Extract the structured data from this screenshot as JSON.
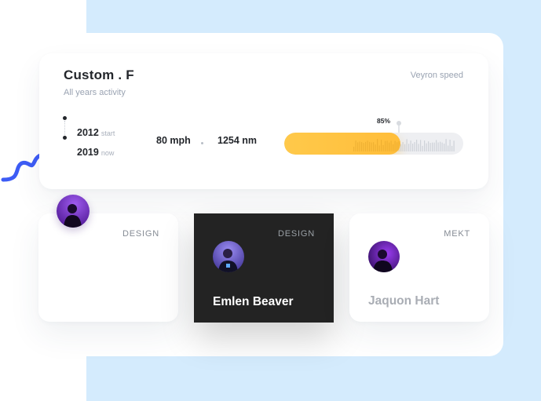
{
  "header": {
    "title": "Custom . F",
    "subtitle": "All years activity",
    "right_label": "Veyron speed"
  },
  "timeline": [
    {
      "year": "2012",
      "note": "start"
    },
    {
      "year": "2019",
      "note": "now"
    }
  ],
  "stats": {
    "speed": "80 mph",
    "distance": "1254 nm"
  },
  "progress": {
    "label": "85%",
    "fill_fraction": 0.65
  },
  "cards": [
    {
      "tag": "DESIGN",
      "name": ""
    },
    {
      "tag": "DESIGN",
      "name": "Emlen Beaver"
    },
    {
      "tag": "MEKT",
      "name": "Jaquon Hart"
    }
  ],
  "colors": {
    "background_blue": "#d4ebfd",
    "accent_yellow": "#ffc94a",
    "squiggle_blue": "#3d5cf5",
    "dark_card": "#232323",
    "avatar_purple": "#6a22c8"
  }
}
